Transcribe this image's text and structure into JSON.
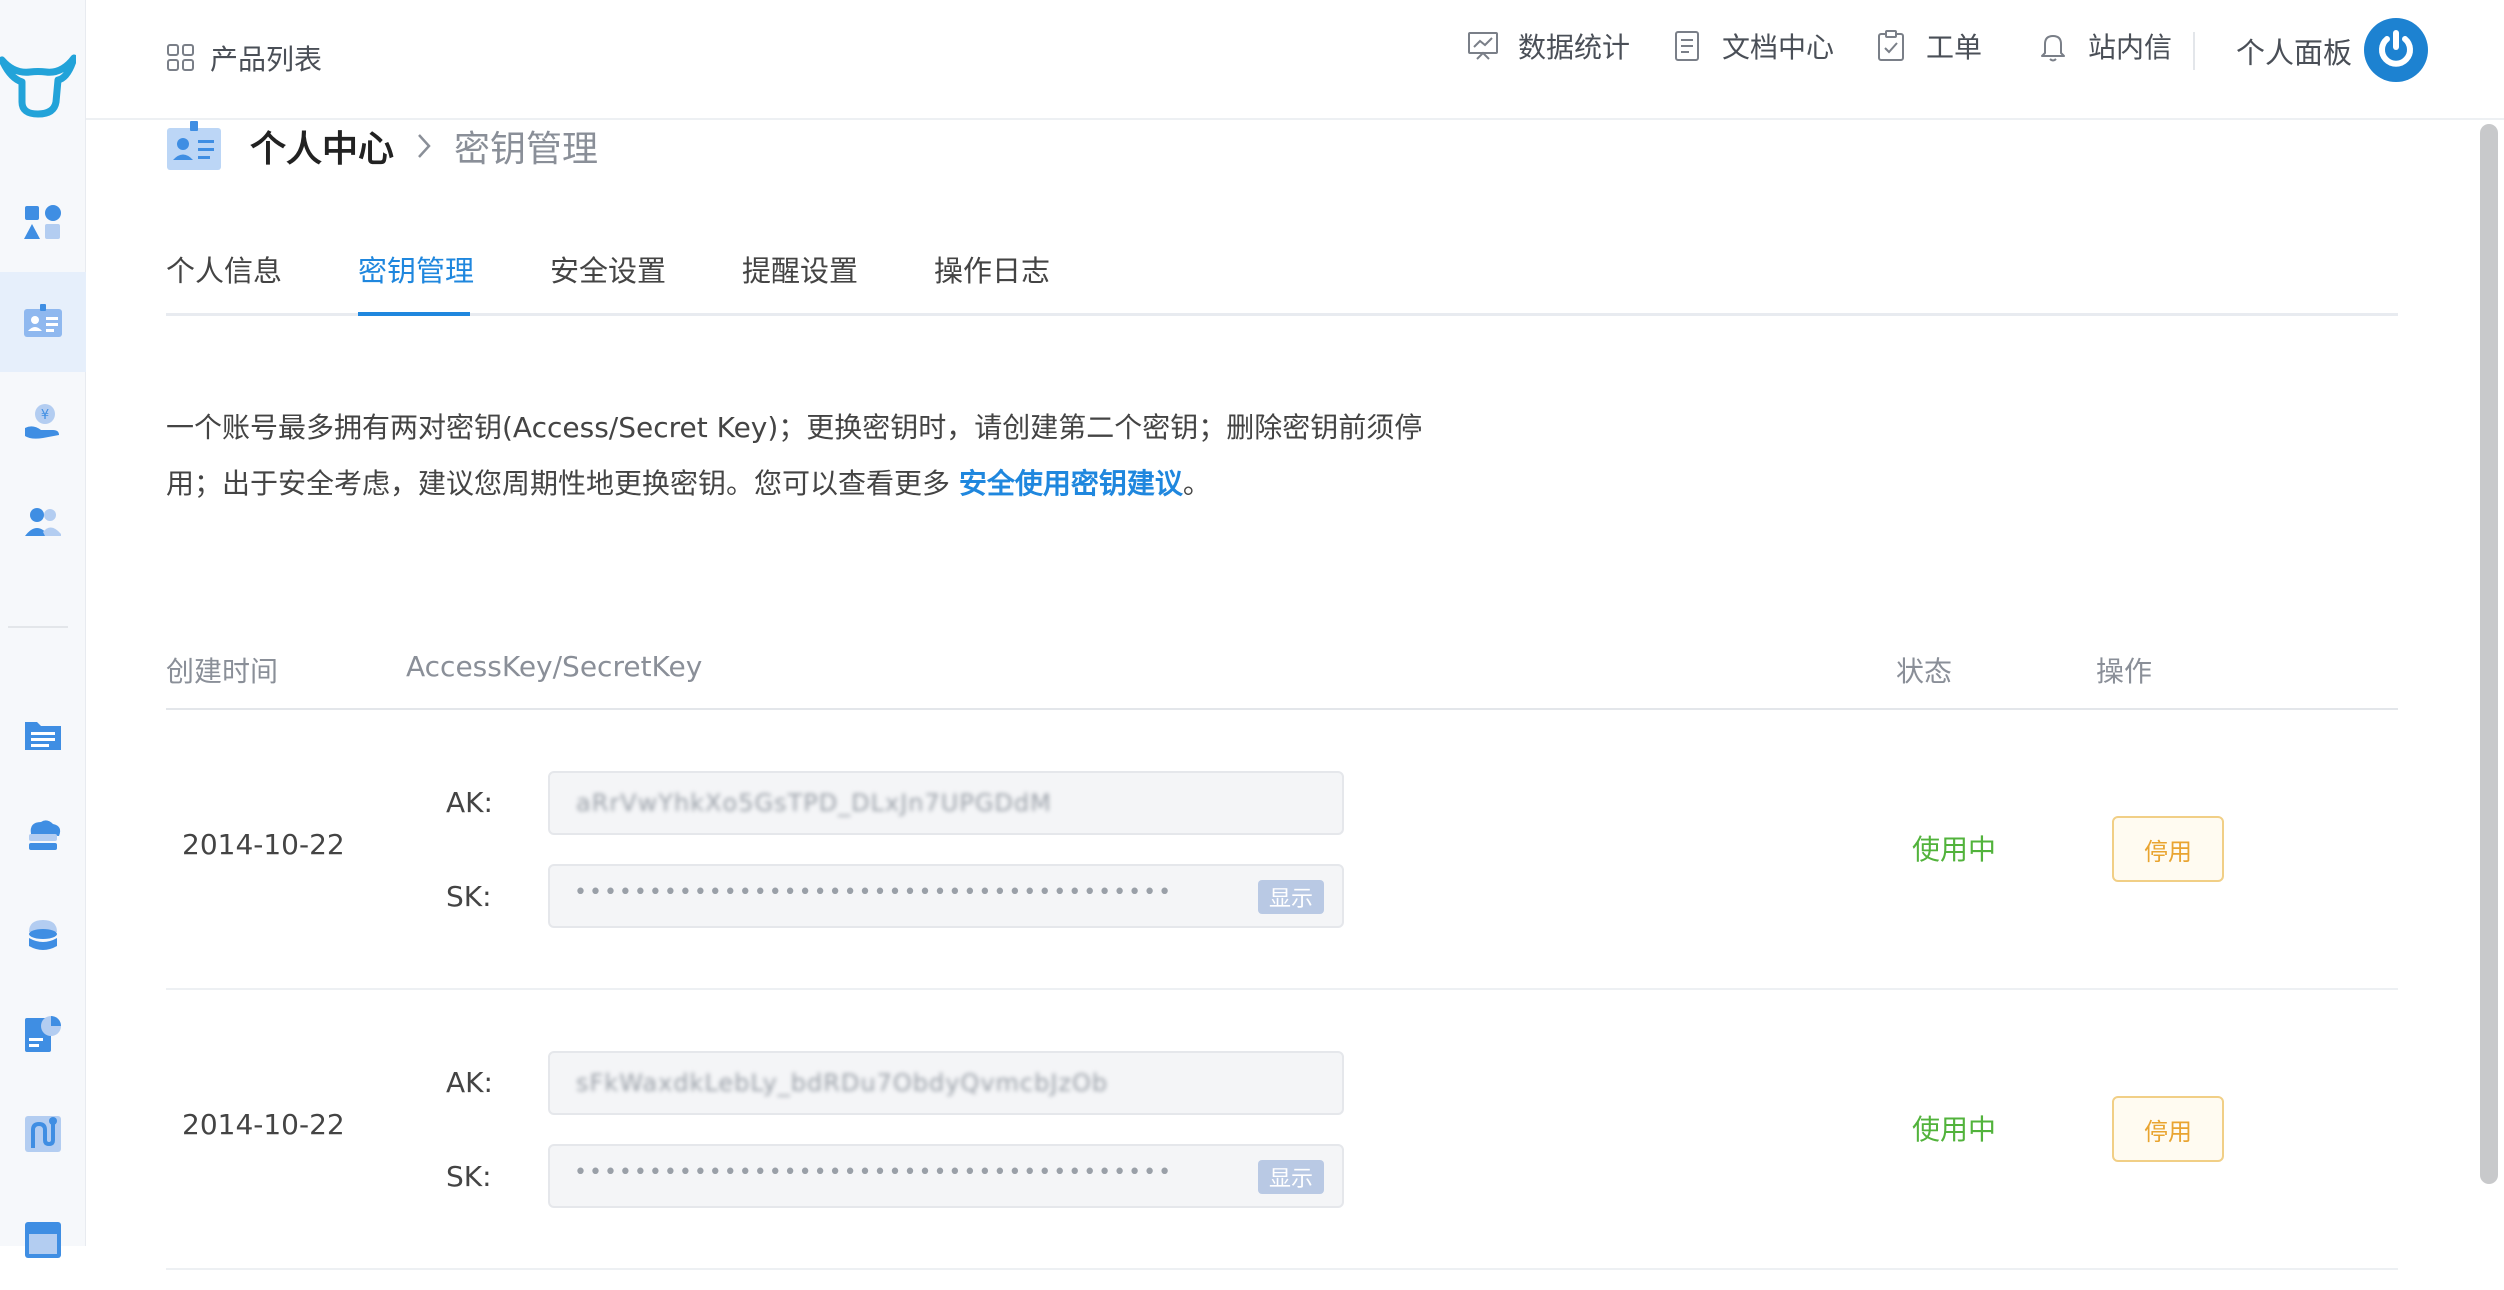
{
  "header": {
    "products_label": "产品列表",
    "nav": [
      {
        "label": "数据统计",
        "icon": "chart-icon"
      },
      {
        "label": "文档中心",
        "icon": "document-icon"
      },
      {
        "label": "工单",
        "icon": "ticket-icon"
      },
      {
        "label": "站内信",
        "icon": "bell-icon"
      }
    ],
    "panel_label": "个人面板"
  },
  "breadcrumb": {
    "parent": "个人中心",
    "current": "密钥管理"
  },
  "tabs": [
    {
      "label": "个人信息",
      "active": false
    },
    {
      "label": "密钥管理",
      "active": true
    },
    {
      "label": "安全设置",
      "active": false
    },
    {
      "label": "提醒设置",
      "active": false
    },
    {
      "label": "操作日志",
      "active": false
    }
  ],
  "description": {
    "line1": "一个账号最多拥有两对密钥(Access/Secret Key)；更换密钥时，请创建第二个密钥；删除密钥前须停",
    "line2_prefix": "用；出于安全考虑，建议您周期性地更换密钥。您可以查看更多 ",
    "link": "安全使用密钥建议",
    "line2_suffix": "。"
  },
  "table": {
    "columns": {
      "created": "创建时间",
      "keys": "AccessKey/SecretKey",
      "status": "状态",
      "action": "操作"
    },
    "ak_label": "AK:",
    "sk_label": "SK:",
    "show_label": "显示",
    "rows": [
      {
        "date": "2014-10-22",
        "ak": "aRrVwYhkXo5GsTPD_DLxJn7UPGDdM",
        "sk_masked": "••••••••••••••••••••••••••••••••••••••••",
        "status": "使用中",
        "action": "停用"
      },
      {
        "date": "2014-10-22",
        "ak": "sFkWaxdkLebLy_bdRDu7ObdyQvmcbJzOb",
        "sk_masked": "••••••••••••••••••••••••••••••••••••••••",
        "status": "使用中",
        "action": "停用"
      }
    ]
  },
  "colors": {
    "accent": "#1f87de",
    "status_ok": "#52b33c",
    "warn": "#e9a430"
  }
}
